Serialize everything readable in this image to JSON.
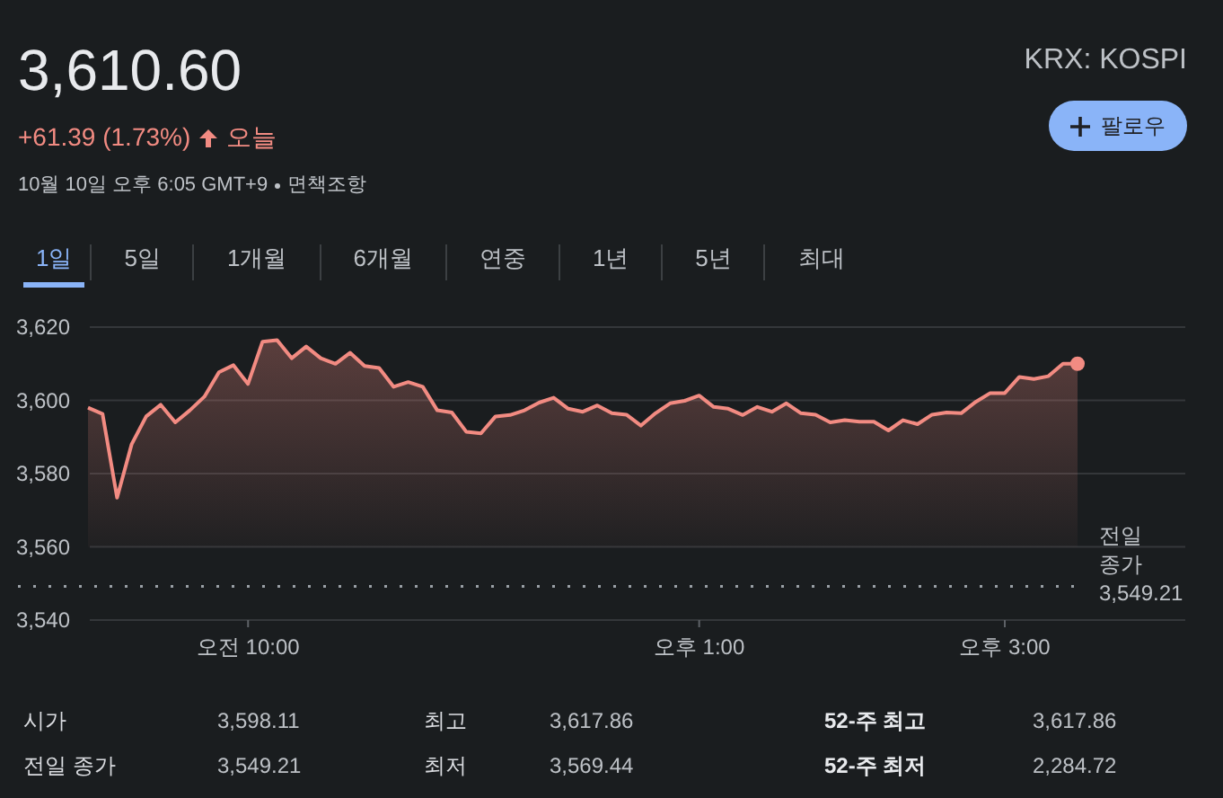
{
  "quote": {
    "price": "3,610.60",
    "change": "+61.39 (1.73%)",
    "period": "오늘",
    "timestamp": "10월 10일 오후 6:05 GMT+9",
    "disclaimer": "면책조항",
    "exchange": "KRX: KOSPI",
    "follow_label": "팔로우"
  },
  "tabs": [
    {
      "label": "1일",
      "selected": true
    },
    {
      "label": "5일",
      "selected": false
    },
    {
      "label": "1개월",
      "selected": false
    },
    {
      "label": "6개월",
      "selected": false
    },
    {
      "label": "연중",
      "selected": false
    },
    {
      "label": "1년",
      "selected": false
    },
    {
      "label": "5년",
      "selected": false
    },
    {
      "label": "최대",
      "selected": false
    }
  ],
  "chart": {
    "chart_data": {
      "type": "area",
      "categories": [
        null,
        null,
        null,
        null,
        null,
        null,
        null,
        null,
        null,
        null,
        null,
        "오전 10:00",
        null,
        null,
        null,
        null,
        null,
        null,
        null,
        null,
        null,
        null,
        null,
        null,
        null,
        null,
        null,
        null,
        null,
        null,
        null,
        null,
        null,
        null,
        null,
        null,
        null,
        null,
        null,
        null,
        null,
        null,
        "오후 1:00",
        null,
        null,
        null,
        null,
        null,
        null,
        null,
        null,
        null,
        null,
        null,
        null,
        null,
        null,
        null,
        null,
        null,
        null,
        null,
        null,
        "오후 3:00",
        null,
        null,
        null,
        null,
        null
      ],
      "series": [
        {
          "color": "#f28b82",
          "values": [
            3598,
            3596.3,
            3573.4,
            3588,
            3595.6,
            3598.8,
            3594,
            3597.3,
            3601,
            3607.7,
            3609.6,
            3604.5,
            3616,
            3616.4,
            3611.5,
            3614.7,
            3611.5,
            3610,
            3613,
            3609.4,
            3608.8,
            3603.7,
            3605,
            3603.7,
            3597.3,
            3596.7,
            3591.4,
            3591,
            3595.6,
            3596,
            3597.3,
            3599.4,
            3600.7,
            3597.7,
            3596.9,
            3598.6,
            3596.5,
            3596.1,
            3593.1,
            3596.5,
            3599.2,
            3599.9,
            3601.3,
            3598.2,
            3597.7,
            3596,
            3598.2,
            3596.9,
            3599.2,
            3596.5,
            3596.1,
            3594,
            3594.6,
            3594.2,
            3594.2,
            3591.8,
            3594.6,
            3593.5,
            3596.1,
            3596.7,
            3596.5,
            3599.6,
            3602,
            3602,
            3606.4,
            3605.8,
            3606.6,
            3610,
            3610
          ]
        }
      ],
      "ylim": [
        3540,
        3620
      ],
      "grid": true,
      "yticks": [
        {
          "value": 3540,
          "label": "3,540"
        },
        {
          "value": 3560,
          "label": "3,560"
        },
        {
          "value": 3580,
          "label": "3,580"
        },
        {
          "value": 3600,
          "label": "3,600"
        },
        {
          "value": 3620,
          "label": "3,620"
        }
      ],
      "ref_lines": [
        {
          "axis": "y",
          "value": 3549.21,
          "label": "전일 종가 3,549.21"
        }
      ]
    }
  },
  "stats": [
    {
      "label": "시가",
      "value": "3,598.11"
    },
    {
      "label": "최고",
      "value": "3,617.86"
    },
    {
      "label": "52-주 최고",
      "value": "3,617.86"
    },
    {
      "label": "전일 종가",
      "value": "3,549.21"
    },
    {
      "label": "최저",
      "value": "3,569.44"
    },
    {
      "label": "52-주 최저",
      "value": "2,284.72"
    }
  ]
}
